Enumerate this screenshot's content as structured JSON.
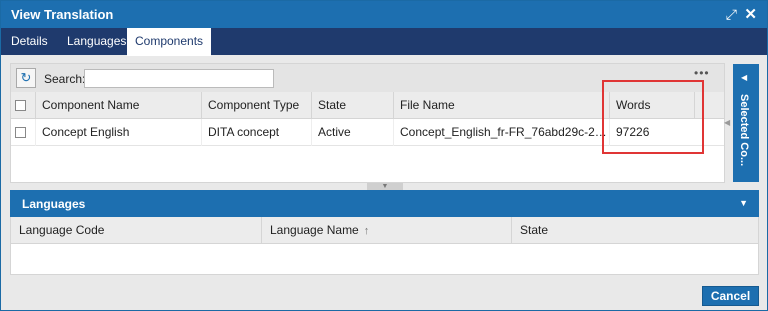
{
  "window": {
    "title": "View Translation"
  },
  "tabs": [
    {
      "label": "Details"
    },
    {
      "label": "Languages"
    },
    {
      "label": "Components",
      "active": true
    }
  ],
  "toolbar": {
    "search_label": "Search:",
    "search_value": ""
  },
  "components_grid": {
    "columns": [
      "Component Name",
      "Component Type",
      "State",
      "File Name",
      "Words"
    ],
    "rows": [
      {
        "name": "Concept English",
        "type": "DITA concept",
        "state": "Active",
        "file_name": "Concept_English_fr-FR_76abd29c-27cb-4...",
        "words": "97226"
      }
    ],
    "more_actions": "•••"
  },
  "side_panel": {
    "label": "Selected Co..."
  },
  "languages_panel": {
    "title": "Languages",
    "columns": [
      "Language Code",
      "Language Name",
      "State"
    ],
    "sort_indicator": "↑"
  },
  "footer": {
    "cancel_label": "Cancel"
  },
  "colors": {
    "accent": "#1d6fb0",
    "tabbar": "#1f3a6d",
    "highlight": "#e03535"
  }
}
